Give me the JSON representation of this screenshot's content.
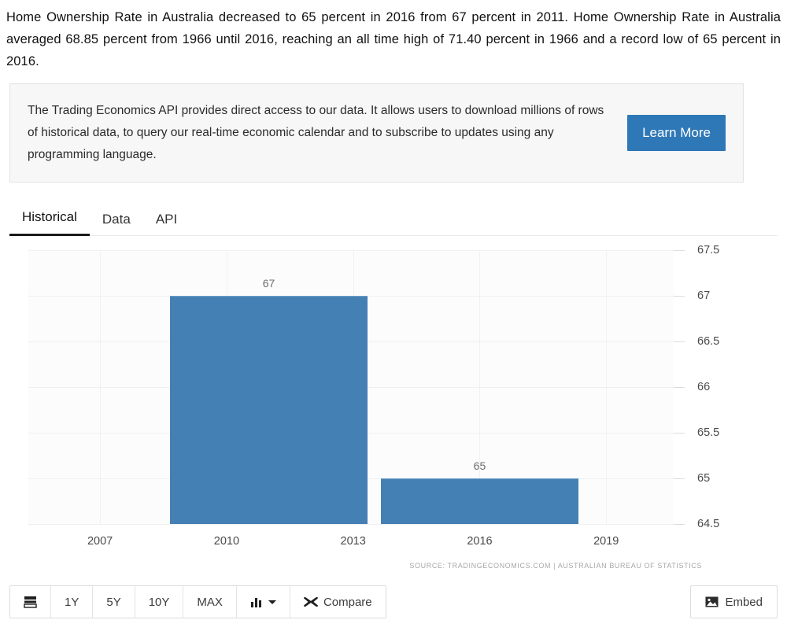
{
  "intro": {
    "paragraph": "Home Ownership Rate in Australia decreased to 65 percent in 2016 from 67 percent in 2011. Home Ownership Rate in Australia averaged 68.85 percent from 1966 until 2016, reaching an all time high of 71.40 percent in 1966 and a record low of 65 percent in 2016."
  },
  "api_promo": {
    "text": "The Trading Economics API provides direct access to our data. It allows users to download millions of rows of historical data, to query our real-time economic calendar and to subscribe to updates using any programming language.",
    "button_label": "Learn More",
    "button_color": "#2f78b7"
  },
  "tabs": [
    {
      "label": "Historical",
      "active": true
    },
    {
      "label": "Data",
      "active": false
    },
    {
      "label": "API",
      "active": false
    }
  ],
  "chart_data": {
    "type": "bar",
    "title": "",
    "xlabel": "",
    "ylabel": "",
    "categories": [
      "2011",
      "2016"
    ],
    "values": [
      67,
      65
    ],
    "data_labels": [
      "67",
      "65"
    ],
    "bar_color": "#4580b4",
    "ylim": [
      64.5,
      67.5
    ],
    "yticks": [
      "67.5",
      "67",
      "66.5",
      "66",
      "65.5",
      "65",
      "64.5"
    ],
    "ytick_values": [
      67.5,
      67,
      66.5,
      66,
      65.5,
      65,
      64.5
    ],
    "xticks": [
      "2007",
      "2010",
      "2013",
      "2016",
      "2019"
    ],
    "xtick_values": [
      2007,
      2010,
      2013,
      2016,
      2019
    ],
    "xlim": [
      2005.3,
      2020.6
    ],
    "grid": true,
    "legend": false,
    "source": "SOURCE: TRADINGECONOMICS.COM | AUSTRALIAN BUREAU OF STATISTICS"
  },
  "toolbar": {
    "calendar_label": "",
    "ranges": [
      "1Y",
      "5Y",
      "10Y",
      "MAX"
    ],
    "chart_type_label": "",
    "compare_label": "Compare",
    "embed_label": "Embed"
  }
}
